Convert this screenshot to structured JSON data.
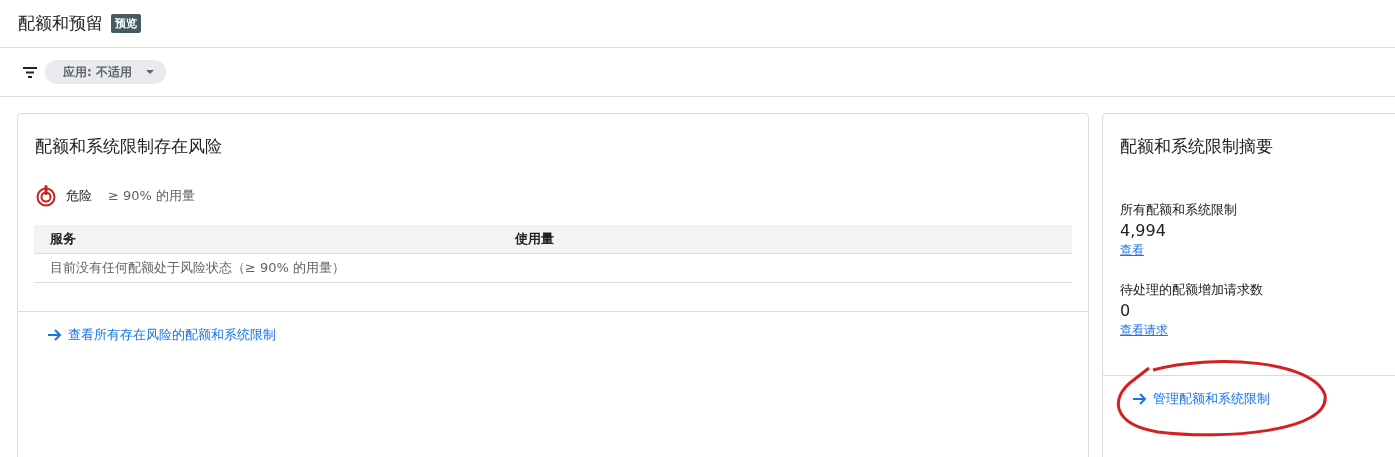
{
  "page": {
    "title": "配额和预留",
    "badge": "预览"
  },
  "filter": {
    "chip": "应用: 不适用"
  },
  "risk_card": {
    "title": "配额和系统限制存在风险",
    "legend": {
      "label": "危险",
      "description": "≥ 90% 的用量"
    },
    "table": {
      "columns": [
        "服务",
        "使用量"
      ],
      "empty_message": "目前没有任何配额处于风险状态（≥ 90% 的用量）"
    },
    "footer_link": {
      "text": "查看所有存在风险的配额和系统限制",
      "circled": false
    }
  },
  "summary_card": {
    "title": "配额和系统限制摘要",
    "stats": [
      {
        "label": "所有配额和系统限制",
        "value": "4,994",
        "link": "查看"
      },
      {
        "label": "待处理的配额增加请求数",
        "value": "0",
        "link": "查看请求"
      }
    ],
    "footer_link": {
      "text": "管理配额和系统限制",
      "circled": true
    }
  }
}
